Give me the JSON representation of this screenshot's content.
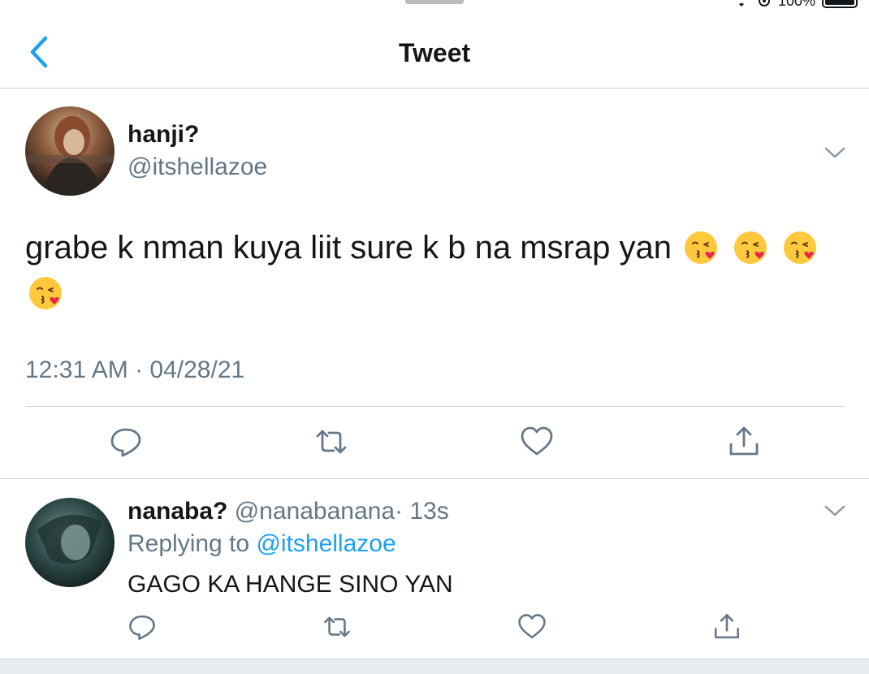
{
  "status": {
    "battery": "100%"
  },
  "nav": {
    "title": "Tweet",
    "back_icon": "chevron-left-icon",
    "accent": "#1da1f2"
  },
  "tweet": {
    "author_name": "hanji?",
    "author_handle": "@itshellazoe",
    "text": "grabe k nman kuya liit sure k b na msrap yan",
    "emoji_name": "face-blowing-kiss-emoji",
    "emoji_count": 4,
    "timestamp": "12:31 AM · 04/28/21",
    "actions": [
      "reply-icon",
      "retweet-icon",
      "like-icon",
      "share-icon"
    ]
  },
  "reply": {
    "author_name": "nanaba?",
    "author_handle": "@nanabanana",
    "age": "· 13s",
    "replying_prefix": "Replying to",
    "replying_to": "@itshellazoe",
    "text": "GAGO KA HANGE SINO YAN"
  },
  "colors": {
    "text": "#14171a",
    "secondary": "#657786",
    "divider": "#cfd3d6",
    "link": "#1da1f2"
  }
}
